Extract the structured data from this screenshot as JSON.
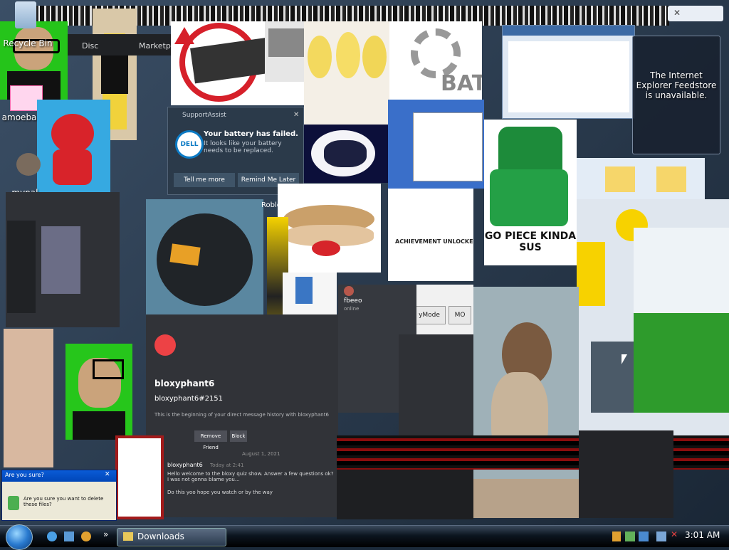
{
  "desktop": {
    "icons": [
      {
        "label": "Recycle Bin"
      },
      {
        "label": "amoeba.JPG"
      },
      {
        "label": "mypal - Shortcut"
      }
    ]
  },
  "feedstore_popup": {
    "text": "The Internet Explorer Feedstore is unavailable."
  },
  "support_assist": {
    "app": "SupportAssist",
    "title": "Your battery has failed.",
    "body": "It looks like your battery needs to be replaced.",
    "btn_more": "Tell me more",
    "btn_later": "Remind Me Later",
    "logo": "DELL"
  },
  "lego_caption": "GO PIECE KINDA SUS",
  "banner_text": "ACHIEVEMENT UNLOCKED",
  "bat_text": "BAT",
  "discord": {
    "username": "bloxyphant6",
    "tag": "bloxyphant6#2151",
    "intro": "This is the beginning of your direct message history with bloxyphant6",
    "btn_add": "Remove Friend",
    "btn_block": "Block",
    "date": "August 1, 2021",
    "msg_author": "bloxyphant6",
    "msg_time": "Today at 2:41",
    "msg1": "Hello welcome to the bloxy quiz show. Answer a few questions ok? I was not gonna blame you...",
    "msg2": "Do this yoo hope you watch or by the way"
  },
  "chat_panel": {
    "name": "fbeeo",
    "status": "online"
  },
  "dialog_small": {
    "title": "Are you sure?",
    "text": "Are you sure you want to delete these files?"
  },
  "button_fragments": {
    "left": "yMode",
    "right": "MO"
  },
  "roblox_fragment": "Roblo",
  "tab_fragments": [
    "Disc",
    "Marketp"
  ],
  "taskbar": {
    "start": "start-orb",
    "active_window": "Downloads",
    "clock": "3:01 AM",
    "quick_launch": [
      "ie-icon",
      "desktop-icon",
      "media-icon"
    ]
  },
  "colors": {
    "discord_dark": "#2b2d31",
    "discord_red": "#ed4245",
    "dell_blue": "#0b7ac4"
  }
}
